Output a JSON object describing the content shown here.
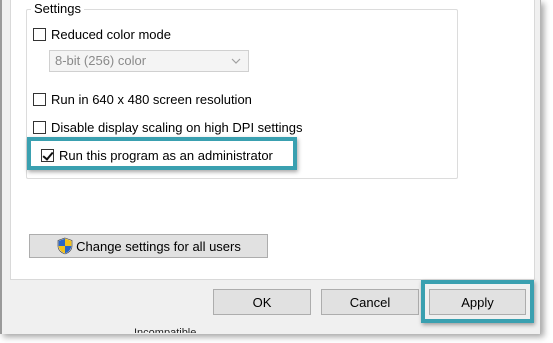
{
  "settings": {
    "group_title": "Settings",
    "reduced_color": {
      "label": "Reduced color mode",
      "checked": false
    },
    "color_select": {
      "value": "8-bit (256) color",
      "enabled": false
    },
    "resolution": {
      "label": "Run in 640 x 480 screen resolution",
      "checked": false
    },
    "dpi": {
      "label": "Disable display scaling on high DPI settings",
      "checked": false
    },
    "admin": {
      "label": "Run this program as an administrator",
      "checked": true
    }
  },
  "change_all_users_label": "Change settings for all users",
  "buttons": {
    "ok": "OK",
    "cancel": "Cancel",
    "apply": "Apply"
  },
  "background_text": "Incompatible",
  "highlight_color": "#3aa0b0",
  "icons": {
    "shield": "uac-shield-icon",
    "dropdown": "chevron-down-icon"
  }
}
